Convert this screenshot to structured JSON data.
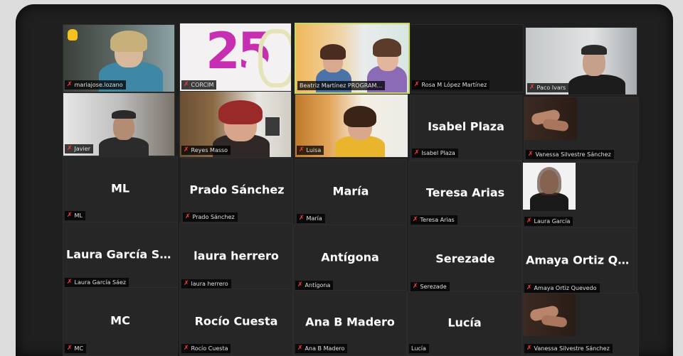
{
  "participants": [
    {
      "label": "mariajose.lozano",
      "big": ""
    },
    {
      "label": "CORCIM",
      "big": ""
    },
    {
      "label": "Beatriz Martínez PROGRAM...",
      "big": ""
    },
    {
      "label": "Rosa M López Martínez",
      "big": ""
    },
    {
      "label": "Paco Ivars",
      "big": ""
    },
    {
      "label": "Javier",
      "big": ""
    },
    {
      "label": "Reyes Masso",
      "big": ""
    },
    {
      "label": "Luisa",
      "big": ""
    },
    {
      "label": "Isabel Plaza",
      "big": "Isabel Plaza"
    },
    {
      "label": "Vanessa Silvestre Sánchez",
      "big": ""
    },
    {
      "label": "ML",
      "big": "ML"
    },
    {
      "label": "Prado Sánchez",
      "big": "Prado Sánchez"
    },
    {
      "label": "María",
      "big": "María"
    },
    {
      "label": "Teresa Arias",
      "big": "Teresa Arias"
    },
    {
      "label": "Laura García",
      "big": ""
    },
    {
      "label": "Laura García Sáez",
      "big": "Laura García Sáez"
    },
    {
      "label": "laura herrero",
      "big": "laura herrero"
    },
    {
      "label": "Antígona",
      "big": "Antígona"
    },
    {
      "label": "Serezade",
      "big": "Serezade"
    },
    {
      "label": "Amaya Ortiz Quevedo",
      "big": "Amaya Ortiz Qu..."
    },
    {
      "label": "MC",
      "big": "MC"
    },
    {
      "label": "Rocío Cuesta",
      "big": "Rocío Cuesta"
    },
    {
      "label": "Ana B Madero",
      "big": "Ana B Madero"
    },
    {
      "label": "Lucía",
      "big": "Lucía"
    },
    {
      "label": "Vanessa Silvestre Sánchez",
      "big": ""
    }
  ],
  "logo_tile": {
    "number": "25"
  },
  "colors": {
    "active_border": "#c7d86a",
    "muted_mic": "#ff3b3b",
    "logo_magenta": "#c72fb3"
  }
}
